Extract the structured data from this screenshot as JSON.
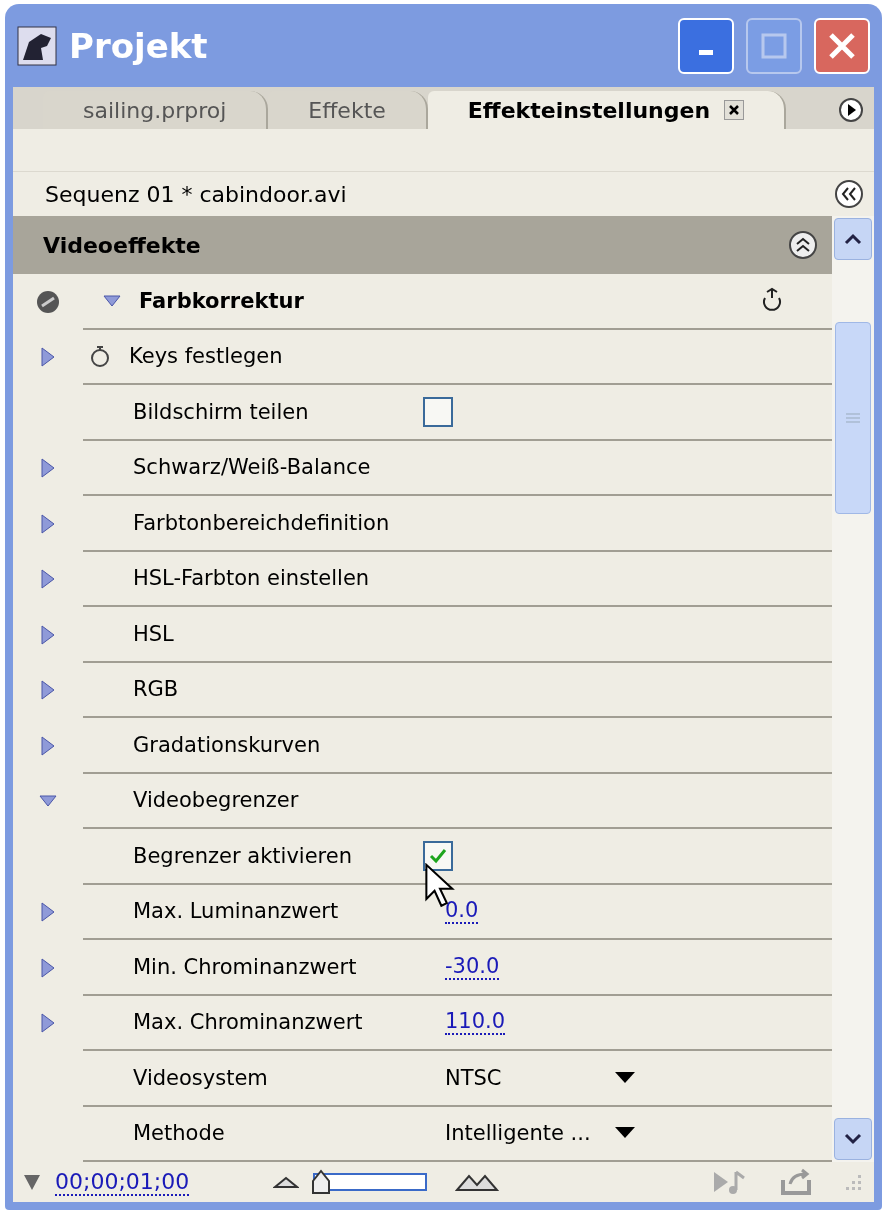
{
  "window": {
    "title": "Projekt"
  },
  "tabs": [
    {
      "label": "sailing.prproj",
      "selected": false,
      "closable": false
    },
    {
      "label": "Effekte",
      "selected": false,
      "closable": false
    },
    {
      "label": "Effekteinstellungen",
      "selected": true,
      "closable": true
    }
  ],
  "sequence_label": "Sequenz 01 * cabindoor.avi",
  "section": {
    "title": "Videoeffekte"
  },
  "rows": [
    {
      "kind": "group",
      "label": "Farbkorrektur",
      "expanded": true
    },
    {
      "kind": "keys",
      "label": "Keys festlegen",
      "expanded": false
    },
    {
      "kind": "checkbox",
      "label": "Bildschirm teilen",
      "checked": false
    },
    {
      "kind": "param",
      "label": "Schwarz/Weiß-Balance",
      "expanded": false
    },
    {
      "kind": "param",
      "label": "Farbtonbereichdefinition",
      "expanded": false
    },
    {
      "kind": "param",
      "label": "HSL-Farbton einstellen",
      "expanded": false
    },
    {
      "kind": "param",
      "label": "HSL",
      "expanded": false
    },
    {
      "kind": "param",
      "label": "RGB",
      "expanded": false
    },
    {
      "kind": "param",
      "label": "Gradationskurven",
      "expanded": false
    },
    {
      "kind": "param",
      "label": "Videobegrenzer",
      "expanded": true
    },
    {
      "kind": "checkbox",
      "label": "Begrenzer aktivieren",
      "checked": true,
      "cursor": true
    },
    {
      "kind": "value",
      "label": "Max. Luminanzwert",
      "expanded": false,
      "value": "0.0"
    },
    {
      "kind": "value",
      "label": "Min. Chrominanzwert",
      "expanded": false,
      "value": "-30.0"
    },
    {
      "kind": "value",
      "label": "Max. Chrominanzwert",
      "expanded": false,
      "value": "110.0"
    },
    {
      "kind": "dropdown",
      "label": "Videosystem",
      "value": "NTSC"
    },
    {
      "kind": "dropdown",
      "label": "Methode",
      "value": "Intelligente ..."
    }
  ],
  "bottom_bar": {
    "timecode": "00;00;01;00",
    "zoom": {
      "level": 0.05
    }
  }
}
